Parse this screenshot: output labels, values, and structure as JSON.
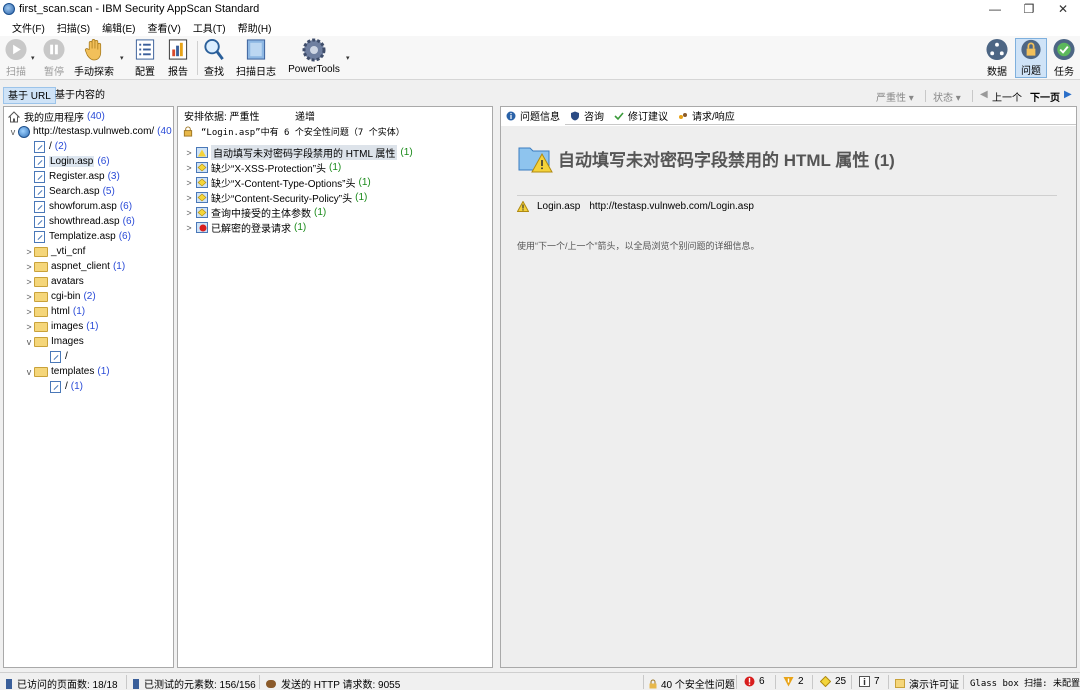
{
  "window": {
    "title": "first_scan.scan - IBM Security AppScan Standard",
    "minimize": "—",
    "restore": "❐",
    "close": "✕"
  },
  "menu": [
    "文件(F)",
    "扫描(S)",
    "编辑(E)",
    "查看(V)",
    "工具(T)",
    "帮助(H)"
  ],
  "toolbar": {
    "scan": "扫描",
    "pause": "暂停",
    "manual_explore": "手动探索",
    "config": "配置",
    "report": "报告",
    "find": "查找",
    "scan_log": "扫描日志",
    "powertools": "PowerTools",
    "data": "数据",
    "issues": "问题",
    "tasks": "任务"
  },
  "viewbar": {
    "by_url": "基于 URL",
    "by_content": "基于内容的",
    "severity": "严重性 ▾",
    "status": "状态 ▾",
    "prev": "上一个",
    "next": "下一页"
  },
  "tree": {
    "root": {
      "label": "我的应用程序",
      "count": "(40)"
    },
    "site": {
      "label": "http://testasp.vulnweb.com/",
      "count": "(40"
    },
    "items": [
      {
        "label": "/",
        "count": "(2)",
        "type": "page",
        "level": 2
      },
      {
        "label": "Login.asp",
        "count": "(6)",
        "type": "page",
        "level": 2,
        "selected": true
      },
      {
        "label": "Register.asp",
        "count": "(3)",
        "type": "page",
        "level": 2
      },
      {
        "label": "Search.asp",
        "count": "(5)",
        "type": "page",
        "level": 2
      },
      {
        "label": "showforum.asp",
        "count": "(6)",
        "type": "page",
        "level": 2
      },
      {
        "label": "showthread.asp",
        "count": "(6)",
        "type": "page",
        "level": 2
      },
      {
        "label": "Templatize.asp",
        "count": "(6)",
        "type": "page",
        "level": 2
      },
      {
        "label": "_vti_cnf",
        "count": "",
        "type": "folder",
        "level": 2,
        "exp": ">"
      },
      {
        "label": "aspnet_client",
        "count": "(1)",
        "type": "folder",
        "level": 2,
        "exp": ">"
      },
      {
        "label": "avatars",
        "count": "",
        "type": "folder",
        "level": 2,
        "exp": ">"
      },
      {
        "label": "cgi-bin",
        "count": "(2)",
        "type": "folder",
        "level": 2,
        "exp": ">"
      },
      {
        "label": "html",
        "count": "(1)",
        "type": "folder",
        "level": 2,
        "exp": ">"
      },
      {
        "label": "images",
        "count": "(1)",
        "type": "folder",
        "level": 2,
        "exp": ">"
      },
      {
        "label": "Images",
        "count": "",
        "type": "folder",
        "level": 2,
        "exp": "v"
      },
      {
        "label": "/",
        "count": "",
        "type": "page",
        "level": 3
      },
      {
        "label": "templates",
        "count": "(1)",
        "type": "folder",
        "level": 2,
        "exp": "v"
      },
      {
        "label": "/",
        "count": "(1)",
        "type": "page",
        "level": 3
      }
    ]
  },
  "issues_panel": {
    "sort_by": "安排依据: 严重性",
    "sort_order": "递增",
    "summary": "“Login.asp”中有 6 个安全性问题（7 个实体）",
    "rows": [
      {
        "label": "自动填写未对密码字段禁用的 HTML 属性",
        "count": "(1)",
        "sev": "info",
        "selected": true
      },
      {
        "label": "缺少“X-XSS-Protection”头",
        "count": "(1)",
        "sev": "low"
      },
      {
        "label": "缺少“X-Content-Type-Options”头",
        "count": "(1)",
        "sev": "low"
      },
      {
        "label": "缺少“Content-Security-Policy”头",
        "count": "(1)",
        "sev": "low"
      },
      {
        "label": "查询中接受的主体参数",
        "count": "(1)",
        "sev": "low"
      },
      {
        "label": "已解密的登录请求",
        "count": "(1)",
        "sev": "high"
      }
    ]
  },
  "detail_panel": {
    "tabs": [
      "问题信息",
      "咨询",
      "修订建议",
      "请求/响应"
    ],
    "title": "自动填写未对密码字段禁用的 HTML 属性 (1)",
    "entity_name": "Login.asp",
    "entity_url": "http://testasp.vulnweb.com/Login.asp",
    "hint": "使用“下一个/上一个”箭头，以全局浏览个别问题的详细信息。"
  },
  "statusbar": {
    "visited": "已访问的页面数: 18/18",
    "tested": "已测试的元素数: 156/156",
    "requests": "发送的 HTTP 请求数: 9055",
    "security_issues": "40 个安全性问题",
    "high": "6",
    "medium": "2",
    "low": "25",
    "info": "7",
    "license": "演示许可证",
    "glassbox": "Glass box 扫描: 未配置"
  },
  "colors": {
    "accent": "#2a4bd7",
    "count_green": "#1a8a1a",
    "severity_high": "#d81e1e",
    "severity_medium": "#e8a317",
    "severity_low": "#f3d53b"
  }
}
